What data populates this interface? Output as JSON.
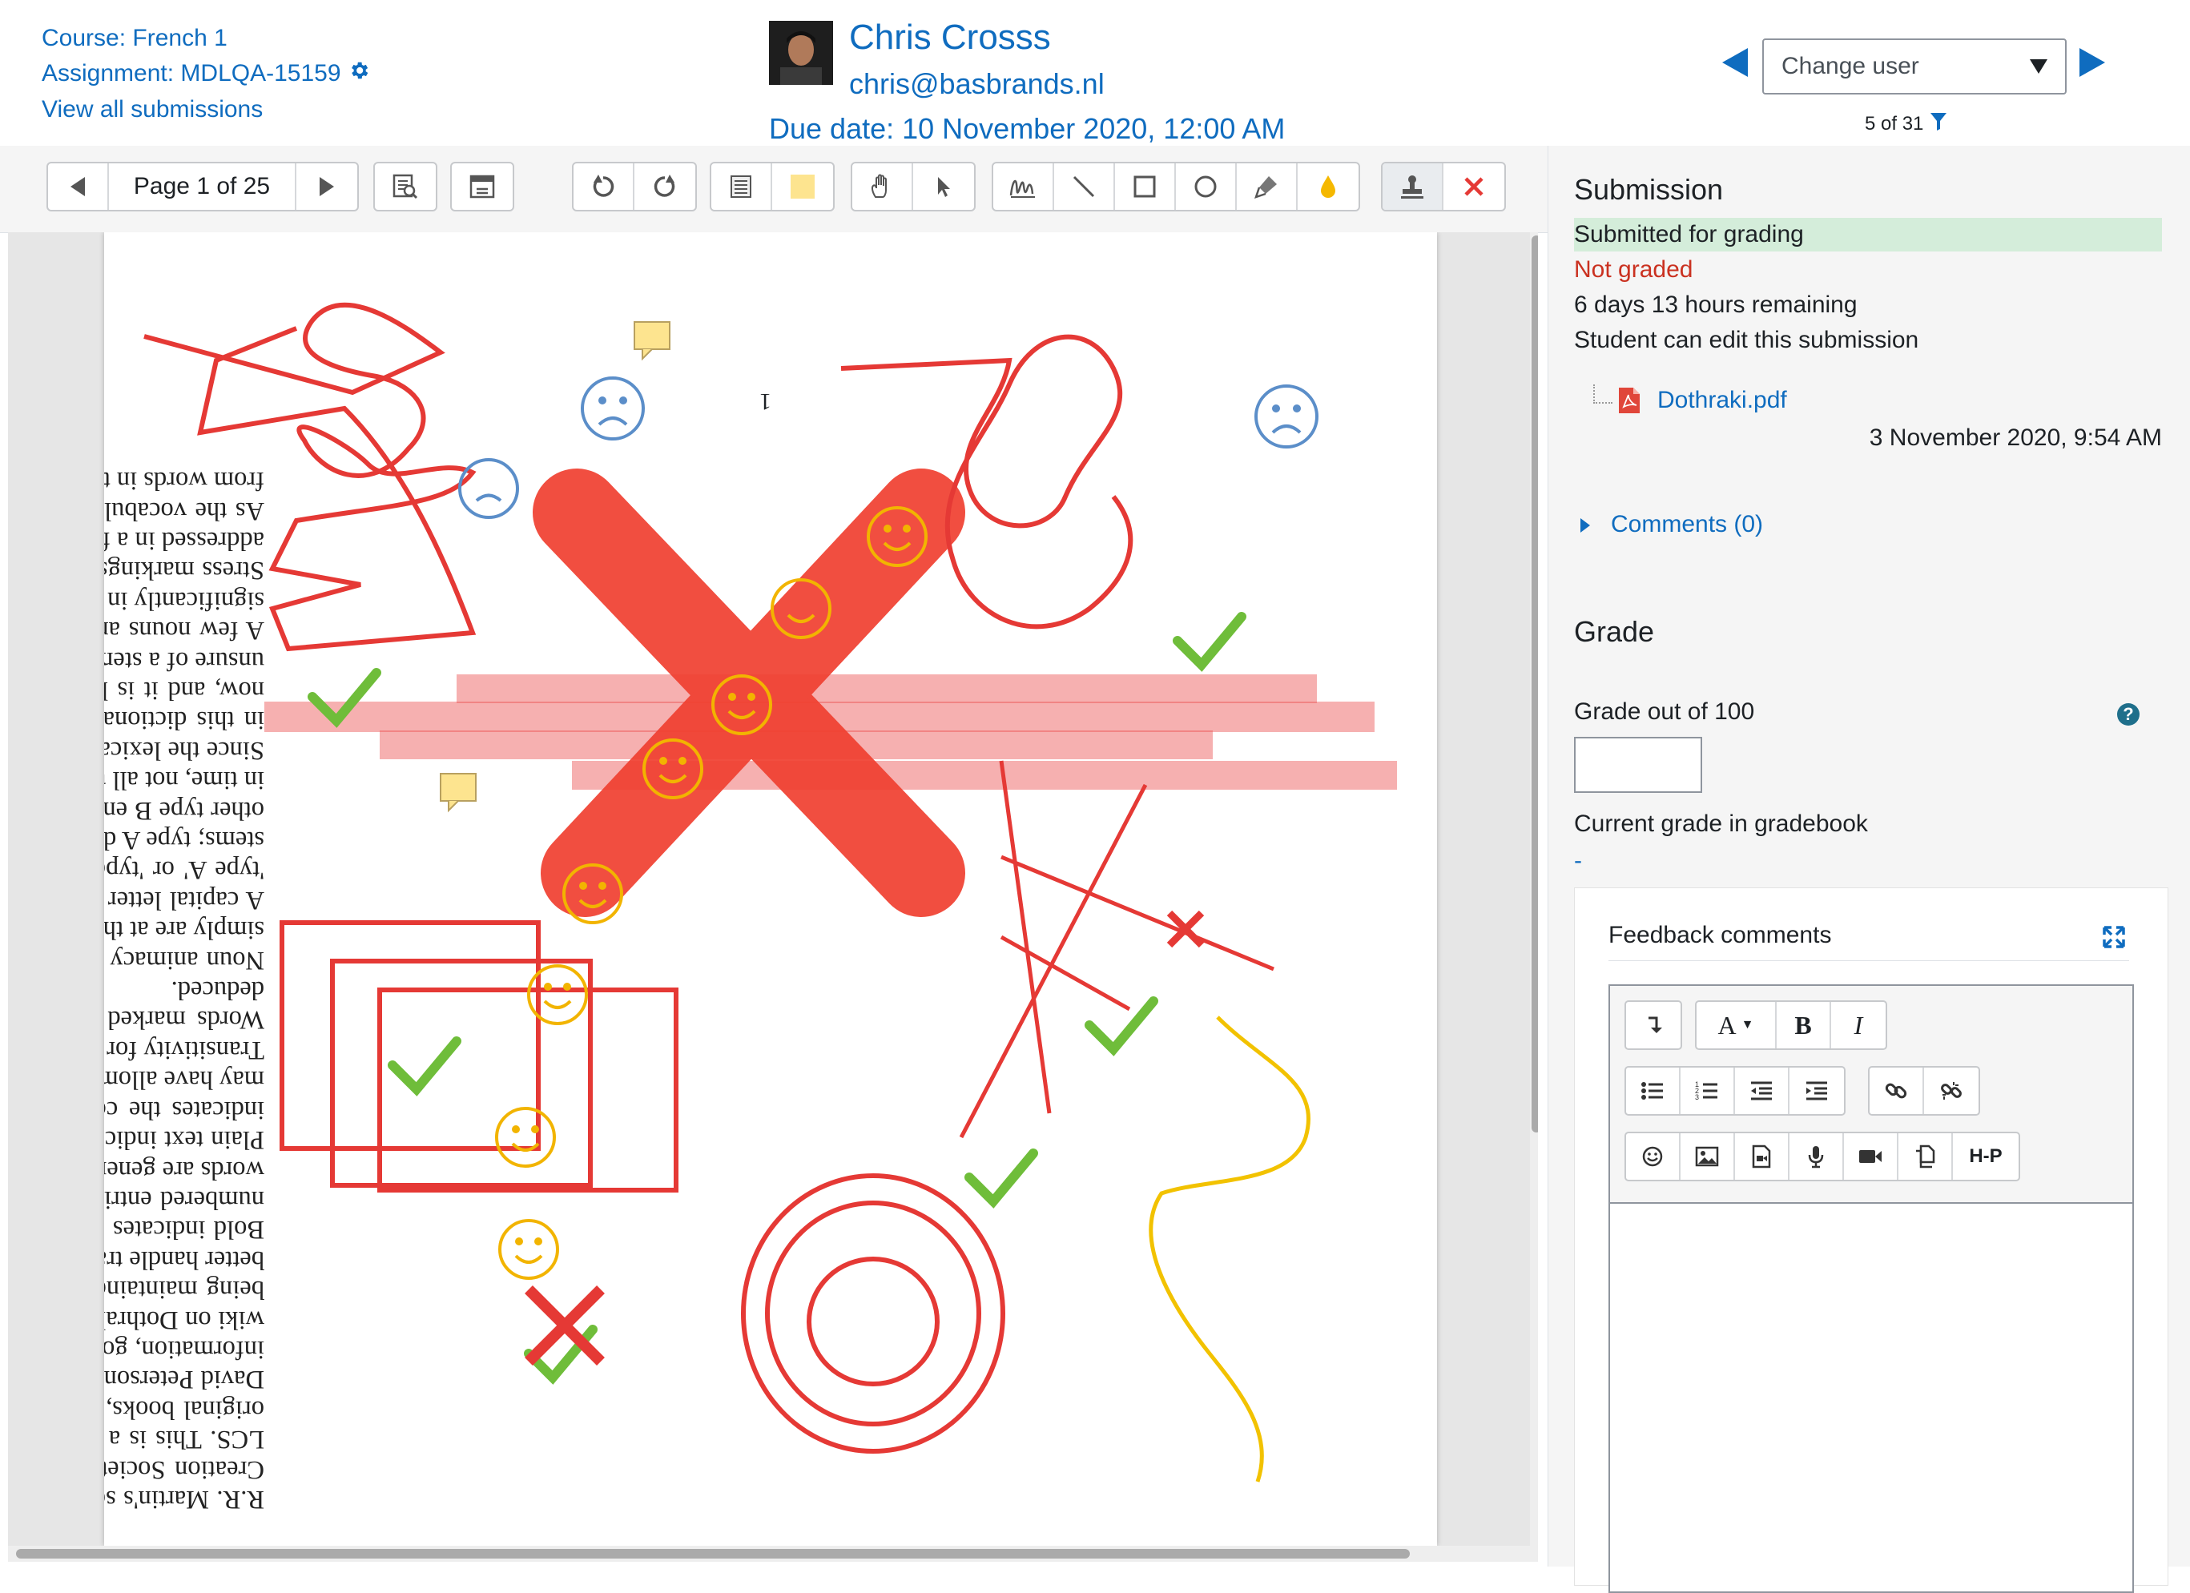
{
  "header": {
    "course": "Course: French 1",
    "assignment": "Assignment: MDLQA-15159",
    "view_all": "View all submissions",
    "user_name": "Chris Crosss",
    "user_email": "chris@basbrands.nl",
    "due_date": "Due date: 10 November 2020, 12:00 AM",
    "change_user": "Change user",
    "count": "5 of 31",
    "accent_color": "#0f6cbf"
  },
  "toolbar": {
    "page_label": "Page 1 of 25",
    "icons": [
      "prev-page-icon",
      "next-page-icon",
      "search-comments-icon",
      "expand-comments-icon",
      "rotate-left-icon",
      "rotate-right-icon",
      "comment-icon",
      "highlight-color-icon",
      "pan-hand-icon",
      "select-arrow-icon",
      "pen-icon",
      "line-icon",
      "rectangle-icon",
      "oval-icon",
      "highlighter-icon",
      "annotation-color-icon",
      "stamp-icon",
      "stamp-cross-icon"
    ]
  },
  "document": {
    "page_number": "1",
    "paragraphs": [
      "R.R. Martin's series, A Song of Ice and Fire. It was created by David Peterson, of the Language Creation Society, for the HBO adaptation of the series: all copyright belongs to HBO and the LCS. This is a dictionary only of publicly made information, from posts on the LCS blog, the original books, David Peterson's blog and personal emails. Words which have been created by David Peterson are listed as DP. Words created from the original book are listed as M. For more information, go to dothraki.org. As the main thrust of the vocabulary development is now on the wiki on Dothraki.org, an attempt is being made to keep these versions in sync. This dictionary is being maintained as it is more portable and searchable than the wiki. In the future, it can also better handle translations into other languages.",
      "Bold indicates a Dothraki word. Italics indicate the English definition. There are now separate, numbered entries for each word that has different definitions for different parts of speech (root words are generally excluded from this practice).",
      "Plain text indicates grammatical categorization; parentheses indicate extra information. The IPA indicates the correct pronunciation, and should now be fully up-to-date. Some transcriptions may have allomorphs, as in [qo] or [qʰo].",
      "Transitivity for verbs is marked if known: vtr. for transitive verbs, and vin. for intransitive verbs. Words marked v. are either unattested or ambitransitive, or their transitivity is unable to be deduced.",
      "Noun animacy is marked na. for animate nouns, and ni. for inanimate nouns. Nouns marked n. simply are at this time unattested for animacy.",
      "A capital letter 'B', or lack thereof, following a part of speech indicates whether a word stem is 'type A' or 'type B'. Type B nouns generally take an epenthetic /e/ when they are shortened to stems; type A do not. All nouns whose stems end in /g/, /w/ or /q/ are type B, and there are some other type B endings as well. Note that the A/B distinction applies to verbs as well. At this point in time, not all type B verbs are marked as such.",
      "Since the lexical form of Dothraki nouns and verbs is the inflected forms, you will not see stems in this dictionary, except in a few rare cases. An attempt is being made to indicate the stems now, and it is hoped that eventually all questionable stem form will show the correct stem. If unsure of a stem form, consult the vocabulary wiki.",
      "A few nouns are given with case endings, as they have specially important meanings, or differ significantly in meaning from what the standard ending implies.",
      "Stress markings have been removed, as stress is fairly predictable, and will be more completely addressed in a future version of this dictionary.",
      "As the vocabularies for High Valyrian and Astapori Valyrian have grown, a few words derived from words in these languages have been noted. Expect to see more of these with"
    ]
  },
  "sidebar": {
    "submission_title": "Submission",
    "status_submitted": "Submitted for grading",
    "status_grading": "Not graded",
    "time_remaining": "6 days 13 hours remaining",
    "can_edit": "Student can edit this submission",
    "file_name": "Dothraki.pdf",
    "file_date": "3 November 2020, 9:54 AM",
    "comments": "Comments (0)",
    "grade_title": "Grade",
    "grade_out_of": "Grade out of 100",
    "current_grade_label": "Current grade in gradebook",
    "current_grade_value": "-",
    "feedback_title": "Feedback comments",
    "editor_toolbar": {
      "row1": [
        "collapse-icon",
        "font-size-icon",
        "bold-icon",
        "italic-icon"
      ],
      "row2": [
        "bullet-list-icon",
        "numbered-list-icon",
        "outdent-icon",
        "indent-icon",
        "link-icon",
        "unlink-icon"
      ],
      "row3": [
        "emoticon-icon",
        "image-icon",
        "media-icon",
        "microphone-icon",
        "video-icon",
        "manage-files-icon",
        "h5p-icon"
      ],
      "bold_label": "B",
      "italic_label": "I",
      "h5p_label": "H-P"
    }
  }
}
